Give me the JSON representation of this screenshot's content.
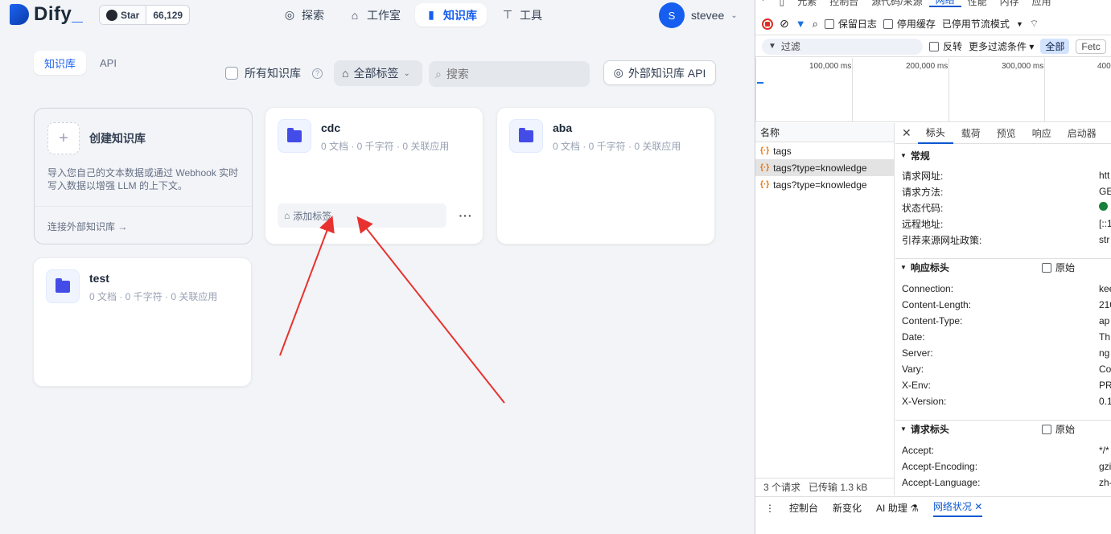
{
  "app": {
    "logo": "Dify",
    "github": {
      "star_label": "Star",
      "count": "66,129"
    },
    "nav": [
      {
        "label": "探索",
        "icon": "compass-icon"
      },
      {
        "label": "工作室",
        "icon": "robot-icon"
      },
      {
        "label": "知识库",
        "icon": "book-icon"
      },
      {
        "label": "工具",
        "icon": "hammer-icon"
      }
    ],
    "user": {
      "initial": "S",
      "name": "stevee"
    },
    "subtabs": [
      "知识库",
      "API"
    ],
    "all_kb_label": "所有知识库",
    "tag_filter_label": "全部标签",
    "search_placeholder": "搜索",
    "ext_api_label": "外部知识库 API",
    "create_card": {
      "title": "创建知识库",
      "desc": "导入您自己的文本数据或通过 Webhook 实时写入数据以增强 LLM 的上下文。",
      "link": "连接外部知识库 →"
    },
    "knowledge": [
      {
        "name": "cdc",
        "meta": "0 文档 · 0 千字符 · 0 关联应用",
        "tag_label": "添加标签"
      },
      {
        "name": "aba",
        "meta": "0 文档 · 0 千字符 · 0 关联应用"
      },
      {
        "name": "test",
        "meta": "0 文档 · 0 千字符 · 0 关联应用"
      }
    ],
    "annotation_color": "#e8322f"
  },
  "devtools": {
    "tabs": [
      "元素",
      "控制台",
      "源代码/来源",
      "网络",
      "性能",
      "内存",
      "应用"
    ],
    "toolbar": {
      "preserve_log": "保留日志",
      "disable_cache": "停用缓存",
      "throttle": "已停用节流模式"
    },
    "filter": {
      "placeholder": "过滤",
      "invert": "反转",
      "more": "更多过滤条件",
      "all": "全部",
      "fetch": "Fetc"
    },
    "overview_ticks": [
      "100,000 ms",
      "200,000 ms",
      "300,000 ms",
      "400"
    ],
    "list_header": "名称",
    "requests": [
      "tags",
      "tags?type=knowledge",
      "tags?type=knowledge"
    ],
    "status_bar": {
      "count": "3 个请求",
      "transferred": "已传输 1.3 kB"
    },
    "detail_tabs": [
      "标头",
      "载荷",
      "预览",
      "响应",
      "启动器"
    ],
    "general": {
      "title": "常规",
      "rows": [
        {
          "k": "请求网址:",
          "v": "htt"
        },
        {
          "k": "请求方法:",
          "v": "GE"
        },
        {
          "k": "状态代码:",
          "v": ""
        },
        {
          "k": "远程地址:",
          "v": "[::1"
        },
        {
          "k": "引荐来源网址政策:",
          "v": "str"
        }
      ]
    },
    "response_headers": {
      "title": "响应标头",
      "raw": "原始",
      "rows": [
        {
          "k": "Connection:",
          "v": "kee"
        },
        {
          "k": "Content-Length:",
          "v": "210"
        },
        {
          "k": "Content-Type:",
          "v": "ap"
        },
        {
          "k": "Date:",
          "v": "Th"
        },
        {
          "k": "Server:",
          "v": "ng"
        },
        {
          "k": "Vary:",
          "v": "Co"
        },
        {
          "k": "X-Env:",
          "v": "PR"
        },
        {
          "k": "X-Version:",
          "v": "0.1"
        }
      ]
    },
    "request_headers": {
      "title": "请求标头",
      "raw": "原始",
      "rows": [
        {
          "k": "Accept:",
          "v": "*/*"
        },
        {
          "k": "Accept-Encoding:",
          "v": "gzi"
        },
        {
          "k": "Accept-Language:",
          "v": "zh-"
        }
      ]
    },
    "drawer": [
      "控制台",
      "新变化",
      "AI 助理",
      "网络状况"
    ]
  }
}
